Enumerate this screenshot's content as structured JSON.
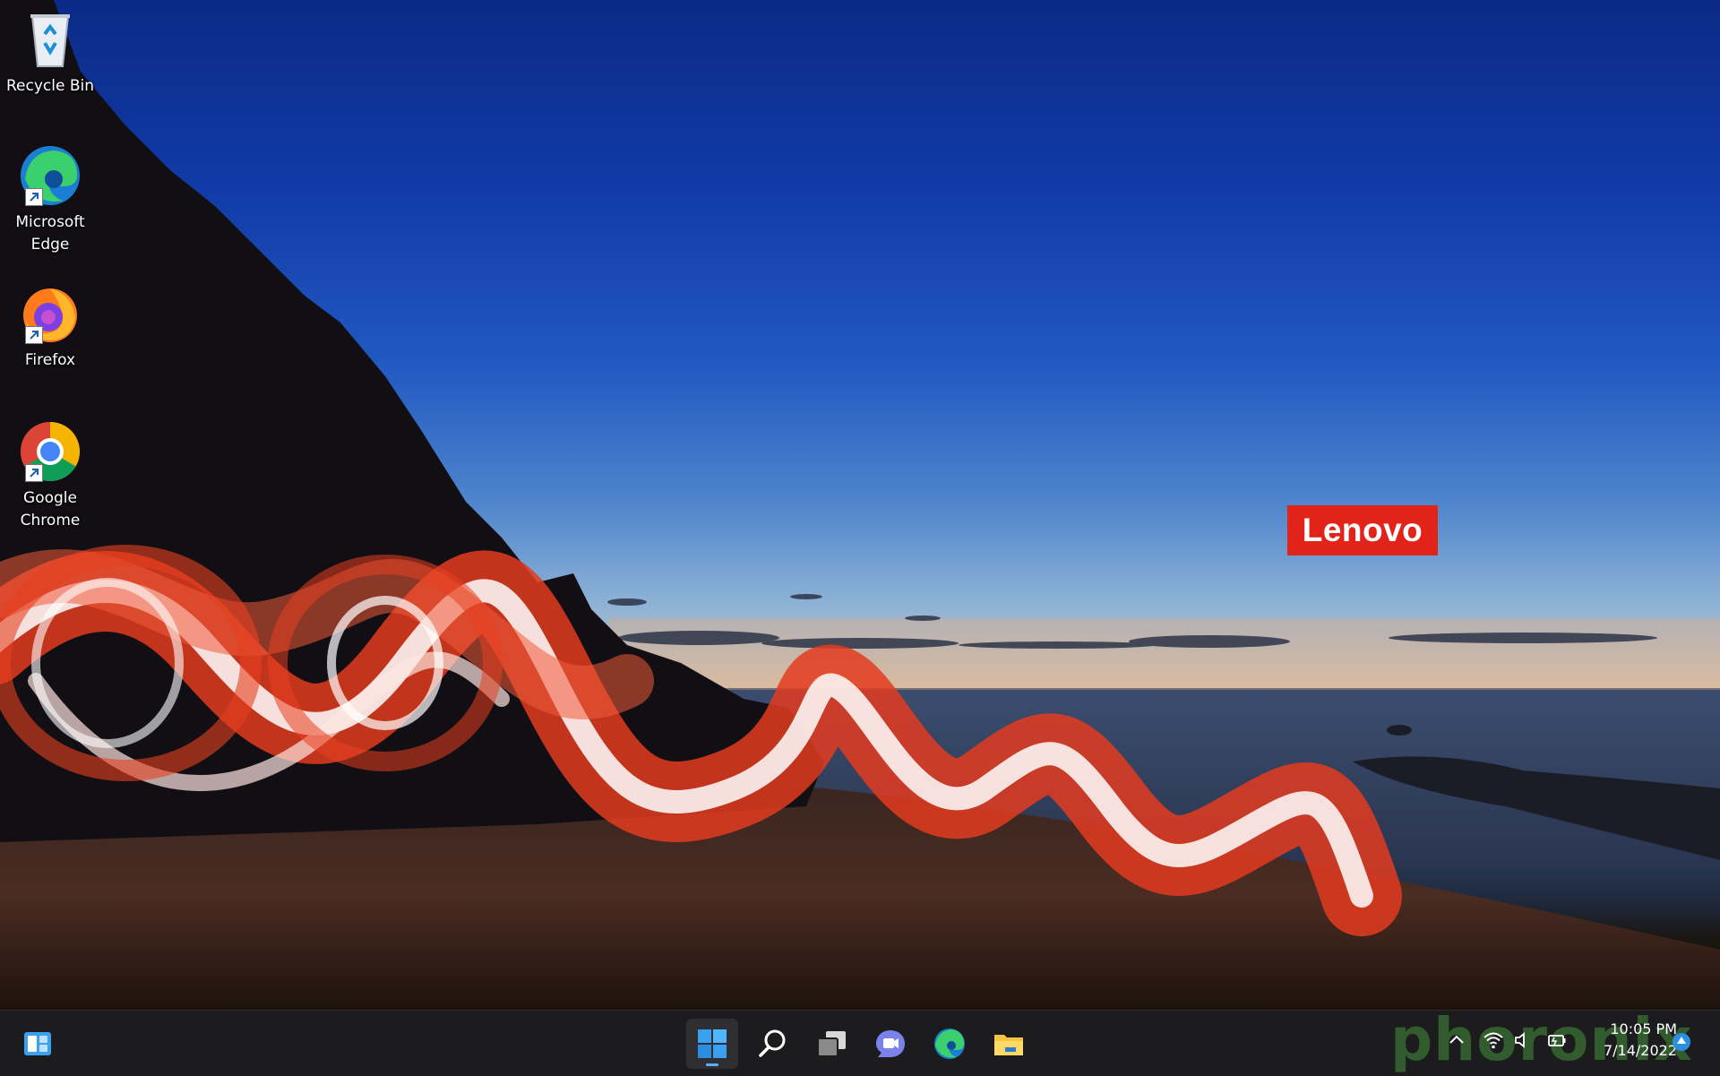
{
  "desktop": {
    "icons": [
      {
        "name": "recycle-bin",
        "label": "Recycle Bin",
        "icon": "recycle-bin-icon"
      },
      {
        "name": "microsoft-edge",
        "label": "Microsoft\nEdge",
        "icon": "edge-icon"
      },
      {
        "name": "firefox",
        "label": "Firefox",
        "icon": "firefox-icon"
      },
      {
        "name": "google-chrome",
        "label": "Google\nChrome",
        "icon": "chrome-icon"
      }
    ],
    "wallpaper_logo": "Lenovo"
  },
  "taskbar": {
    "pinned": [
      {
        "name": "start",
        "icon": "windows-start-icon",
        "active": true
      },
      {
        "name": "search",
        "icon": "search-icon"
      },
      {
        "name": "task-view",
        "icon": "task-view-icon"
      },
      {
        "name": "chat",
        "icon": "teams-chat-icon"
      },
      {
        "name": "edge",
        "icon": "edge-icon"
      },
      {
        "name": "file-explorer",
        "icon": "folder-icon"
      }
    ],
    "tray": [
      "chevron-up-icon",
      "wifi-icon",
      "volume-icon",
      "battery-icon"
    ],
    "clock": {
      "time": "10:05 PM",
      "date": "7/14/2022"
    }
  },
  "watermark": "phoronix",
  "colors": {
    "lenovo_red": "#e2231a",
    "taskbar": "#1c1c1e",
    "start_blue": "#3aa0f0"
  }
}
